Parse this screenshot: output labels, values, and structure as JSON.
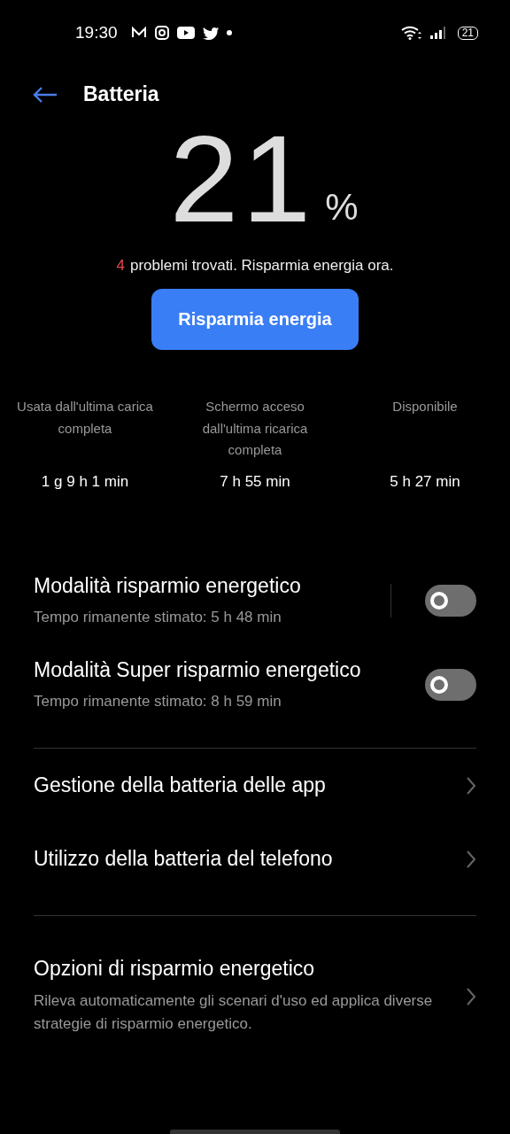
{
  "status_bar": {
    "time": "19:30",
    "battery": "21"
  },
  "header": {
    "title": "Batteria"
  },
  "battery": {
    "percent": "21",
    "unit": "%"
  },
  "issues": {
    "count": "4",
    "text": "problemi trovati. Risparmia energia ora."
  },
  "save_button": {
    "label": "Risparmia energia"
  },
  "stats": [
    {
      "label": "Usata dall'ultima carica completa",
      "value": "1 g 9 h 1 min"
    },
    {
      "label": "Schermo acceso dall'ultima ricarica completa",
      "value": "7 h 55 min"
    },
    {
      "label": "Disponibile",
      "value": "5 h 27 min"
    }
  ],
  "modes": [
    {
      "title": "Modalità risparmio energetico",
      "subtitle": "Tempo rimanente stimato:  5 h 48 min",
      "on": false,
      "separator": true
    },
    {
      "title": "Modalità Super risparmio energetico",
      "subtitle": "Tempo rimanente stimato:  8 h 59 min",
      "on": false,
      "separator": false
    }
  ],
  "links": [
    {
      "title": "Gestione della batteria delle app"
    },
    {
      "title": "Utilizzo della batteria del telefono"
    }
  ],
  "options": {
    "title": "Opzioni di risparmio energetico",
    "description": "Rileva automaticamente gli scenari d'uso ed applica diverse strategie di risparmio energetico."
  }
}
